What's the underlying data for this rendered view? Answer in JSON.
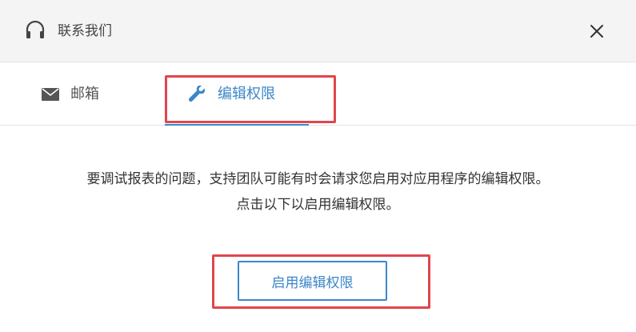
{
  "header": {
    "title": "联系我们",
    "icon": "headset-icon",
    "close_icon": "close-icon"
  },
  "tabs": [
    {
      "label": "邮箱",
      "icon": "mail-icon",
      "active": false
    },
    {
      "label": "编辑权限",
      "icon": "wrench-icon",
      "active": true
    }
  ],
  "content": {
    "message_line1": "要调试报表的问题，支持团队可能有时会请求您启用对应用程序的编辑权限。",
    "message_line2": "点击以下以启用编辑权限。",
    "button_label": "启用编辑权限"
  },
  "colors": {
    "accent": "#3b86c8",
    "highlight": "#e0464c",
    "header_bg": "#f4f4f4"
  }
}
